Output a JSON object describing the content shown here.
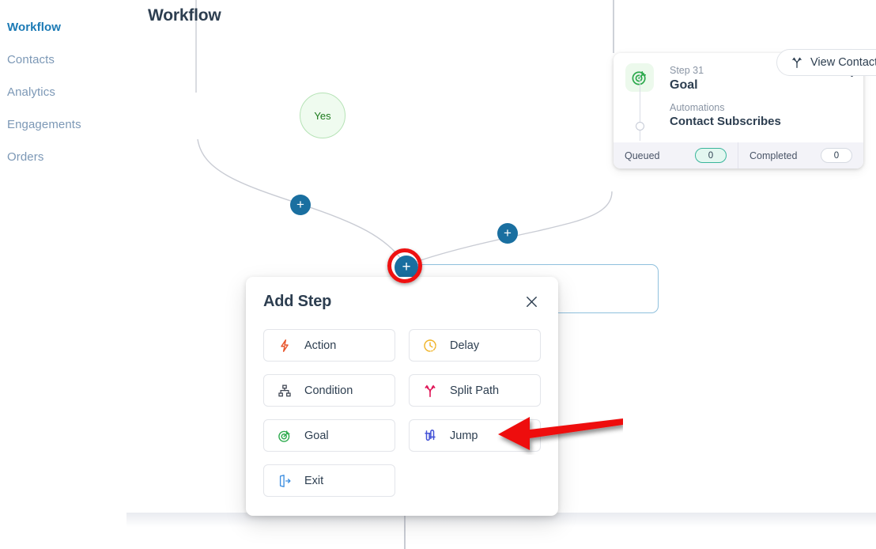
{
  "sidebar": {
    "items": [
      {
        "label": "Workflow",
        "active": true
      },
      {
        "label": "Contacts",
        "active": false
      },
      {
        "label": "Analytics",
        "active": false
      },
      {
        "label": "Engagements",
        "active": false
      },
      {
        "label": "Orders",
        "active": false
      }
    ]
  },
  "canvas": {
    "page_title": "Workflow",
    "branch_node_label": "Yes",
    "plus_buttons": [
      {
        "name": "add-step-plus-left",
        "glyph": "+"
      },
      {
        "name": "add-step-plus-right",
        "glyph": "+"
      },
      {
        "name": "add-step-plus-selected",
        "glyph": "+"
      }
    ]
  },
  "step_card": {
    "step_number": "Step 31",
    "step_type": "Goal",
    "detail_label": "Automations",
    "detail_value": "Contact Subscribes",
    "icon": "goal-target-icon",
    "comment_icon": "comment-bubble-icon",
    "menu_icon": "more-vertical-icon",
    "stats": [
      {
        "label": "Queued",
        "value": "0",
        "style": "queued"
      },
      {
        "label": "Completed",
        "value": "0",
        "style": "completed"
      }
    ]
  },
  "header": {
    "view_contact_label": "View Contact",
    "view_contact_icon": "split-path-icon"
  },
  "dialog": {
    "title": "Add Step",
    "close_icon": "close-icon",
    "options": [
      {
        "label": "Action",
        "icon": "lightning-bolt-icon",
        "color": "#e8542a"
      },
      {
        "label": "Delay",
        "icon": "clock-dashed-icon",
        "color": "#f0b429"
      },
      {
        "label": "Condition",
        "icon": "hierarchy-icon",
        "color": "#3d4451"
      },
      {
        "label": "Split Path",
        "icon": "split-path-icon",
        "color": "#e0195a"
      },
      {
        "label": "Goal",
        "icon": "goal-target-icon",
        "color": "#2eaa4e"
      },
      {
        "label": "Jump",
        "icon": "jump-icon",
        "color": "#4453d6"
      },
      {
        "label": "Exit",
        "icon": "exit-door-icon",
        "color": "#3d8ee0"
      }
    ]
  },
  "annotation": {
    "arrow_color": "#ee1111",
    "highlight_ring_color": "#ee1111",
    "points_at": "Jump"
  },
  "colors": {
    "accent_blue": "#1a6fa0",
    "active_nav": "#1b7ab5",
    "goal_green": "#2eaa4e",
    "queued_teal": "#39b59b"
  }
}
